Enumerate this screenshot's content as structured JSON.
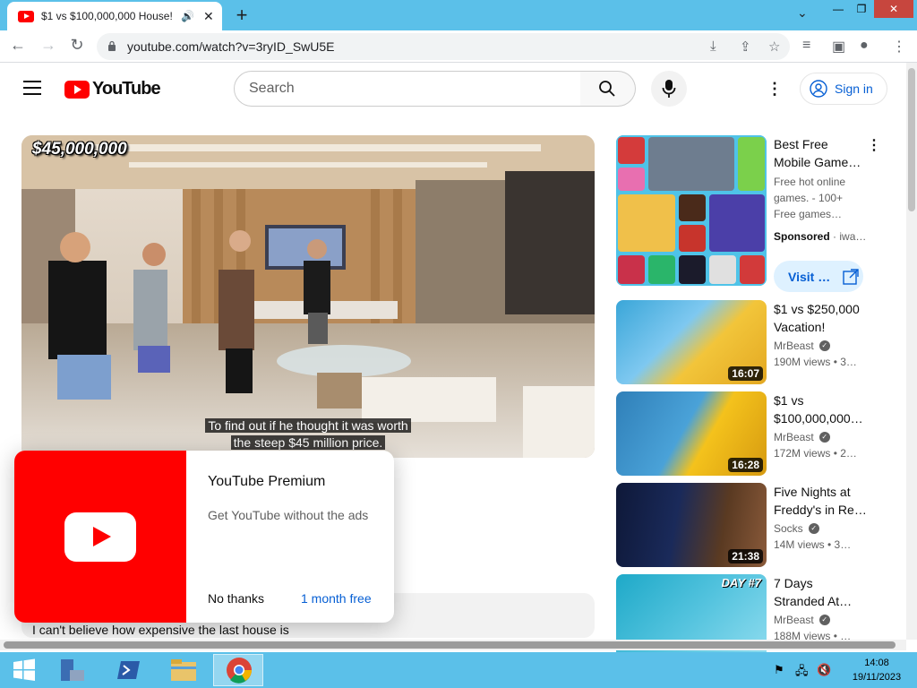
{
  "browser": {
    "tab_title": "$1 vs $100,000,000 House! -",
    "tab_close": "✕",
    "new_tab": "+",
    "tab_dropdown": "⌄",
    "url": "youtube.com/watch?v=3ryID_SwU5E",
    "window_controls": {
      "minimize": "—",
      "restore": "❐",
      "close": "✕"
    }
  },
  "youtube": {
    "logo_text": "YouTube",
    "search_placeholder": "Search",
    "sign_in": "Sign in",
    "more": "⋮"
  },
  "video": {
    "overlay_price": "$45,000,000",
    "caption_line1": "To find out if he thought it was worth",
    "caption_line2": "the steep $45 million price."
  },
  "premium_popup": {
    "title": "YouTube Premium",
    "subtitle": "Get YouTube without the ads",
    "no_thanks": "No thanks",
    "month_free": "1 month free"
  },
  "comment_preview": "I can't believe how expensive the last house is",
  "ad": {
    "title": "Best Free Mobile Game…",
    "description": "Free hot online games. - 100+ Free games…",
    "sponsored": "Sponsored",
    "advertiser": "iwa…",
    "visit": "Visit …"
  },
  "recommendations": [
    {
      "title": "$1 vs $250,000 Vacation!",
      "channel": "MrBeast",
      "meta": "190M views • 3…",
      "duration": "16:07",
      "colors": [
        "#f2c53a",
        "#3aa6d8"
      ]
    },
    {
      "title": "$1 vs $100,000,000…",
      "channel": "MrBeast",
      "meta": "172M views • 2…",
      "duration": "16:28",
      "colors": [
        "#3b92c9",
        "#f4c21c"
      ]
    },
    {
      "title": "Five Nights at Freddy's in Re…",
      "channel": "Socks",
      "meta": "14M views • 3…",
      "duration": "21:38",
      "colors": [
        "#1a2a5a",
        "#6a3a1a"
      ]
    },
    {
      "title": "7 Days Stranded At…",
      "channel": "MrBeast",
      "meta": "188M views • …",
      "duration": "",
      "colors": [
        "#1ea9c8",
        "#8fdcef"
      ]
    }
  ],
  "taskbar": {
    "time": "14:08",
    "date": "19/11/2023"
  }
}
